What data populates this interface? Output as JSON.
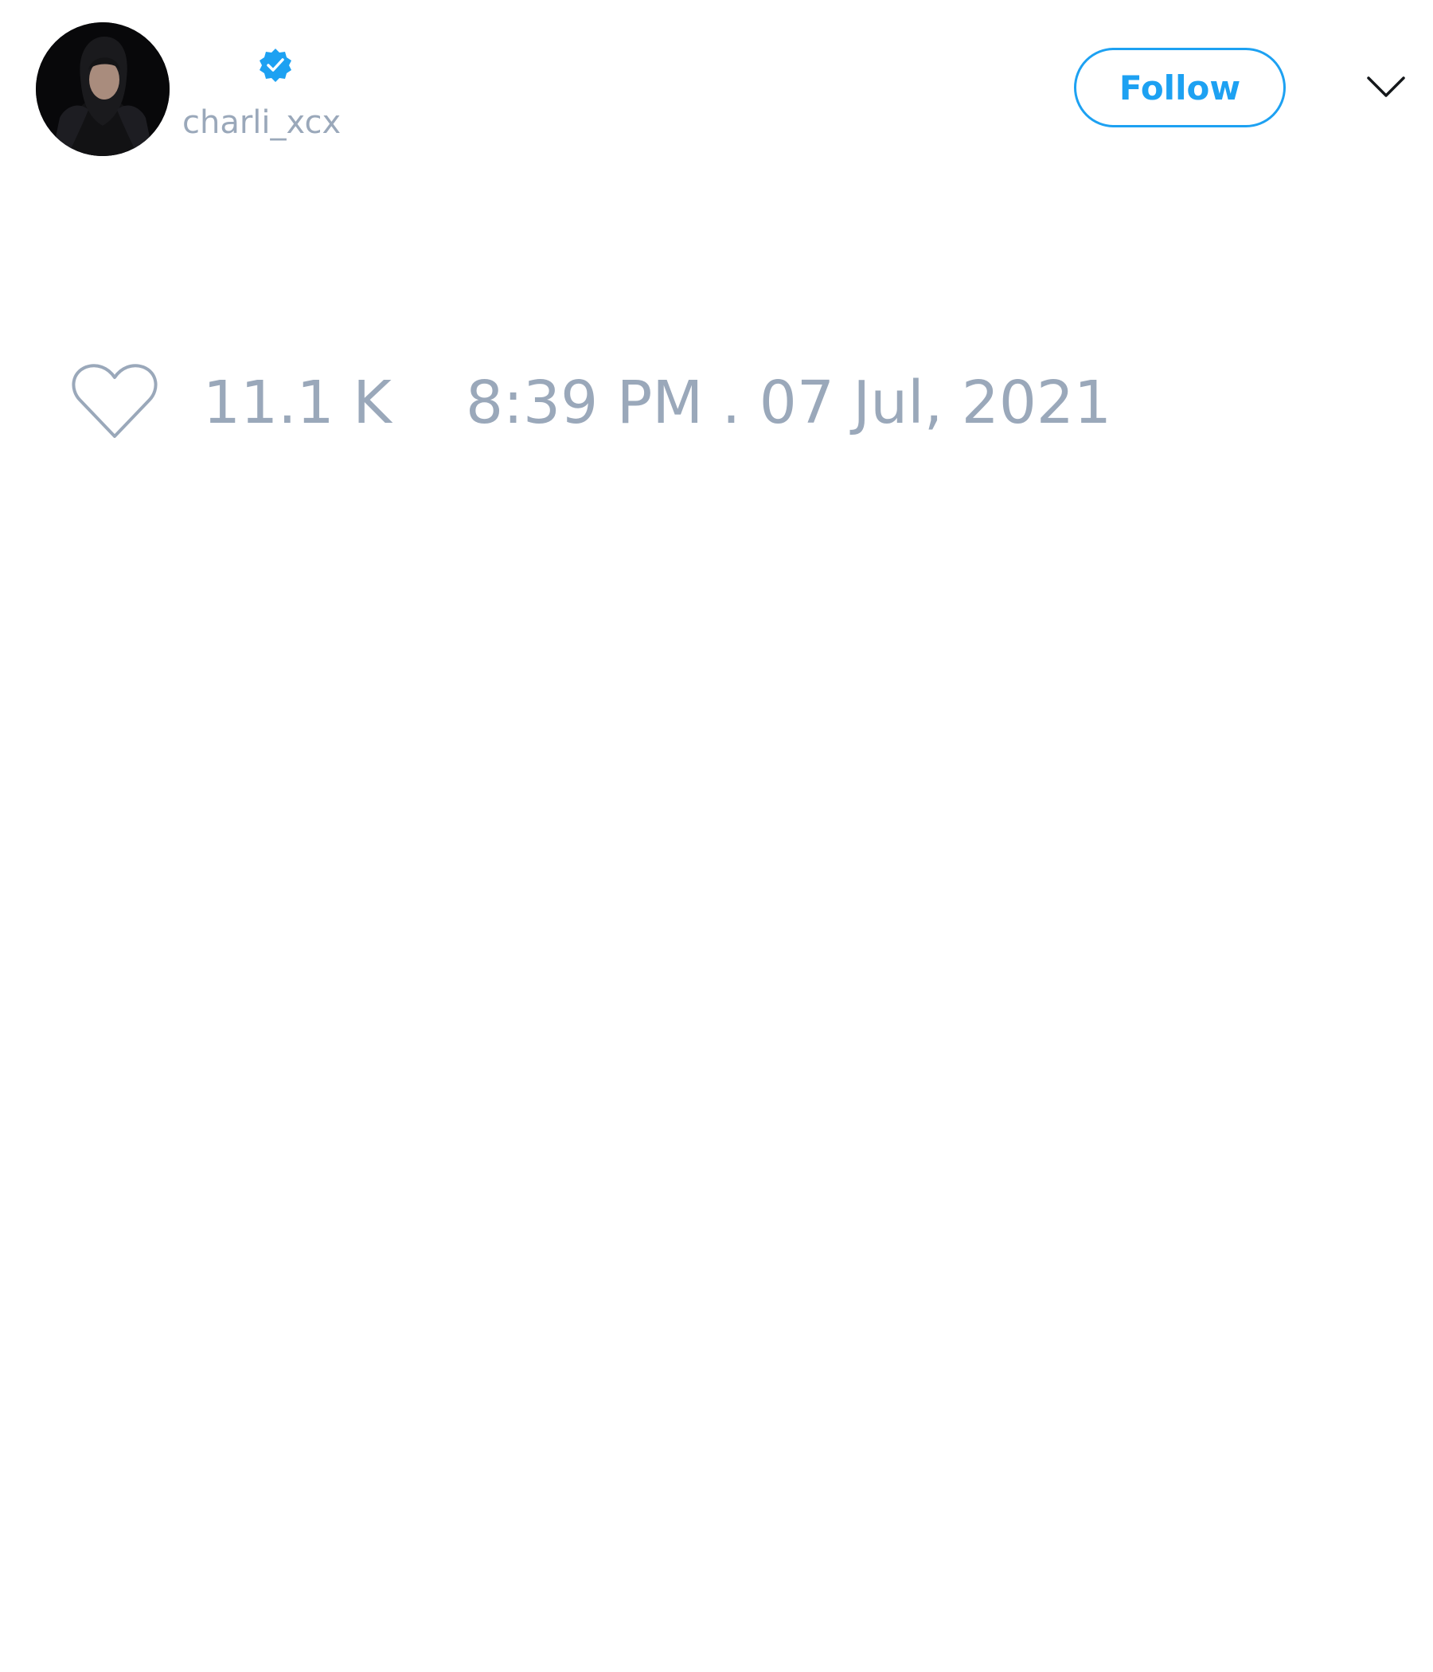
{
  "tweet": {
    "author": {
      "display_name": "",
      "handle": "charli_xcx",
      "verified": true,
      "avatar_icon": "profile-photo"
    },
    "follow_button": {
      "label": "Follow"
    },
    "menu": {
      "icon": "chevron-down-icon"
    },
    "stats": {
      "like_icon": "heart-outline-icon",
      "like_count": "11.1 K",
      "timestamp": "8:39 PM . 07 Jul, 2021"
    }
  },
  "colors": {
    "accent": "#1da1f2",
    "muted_text": "#9aa8ba",
    "background": "#ffffff",
    "chevron": "#14171a"
  }
}
